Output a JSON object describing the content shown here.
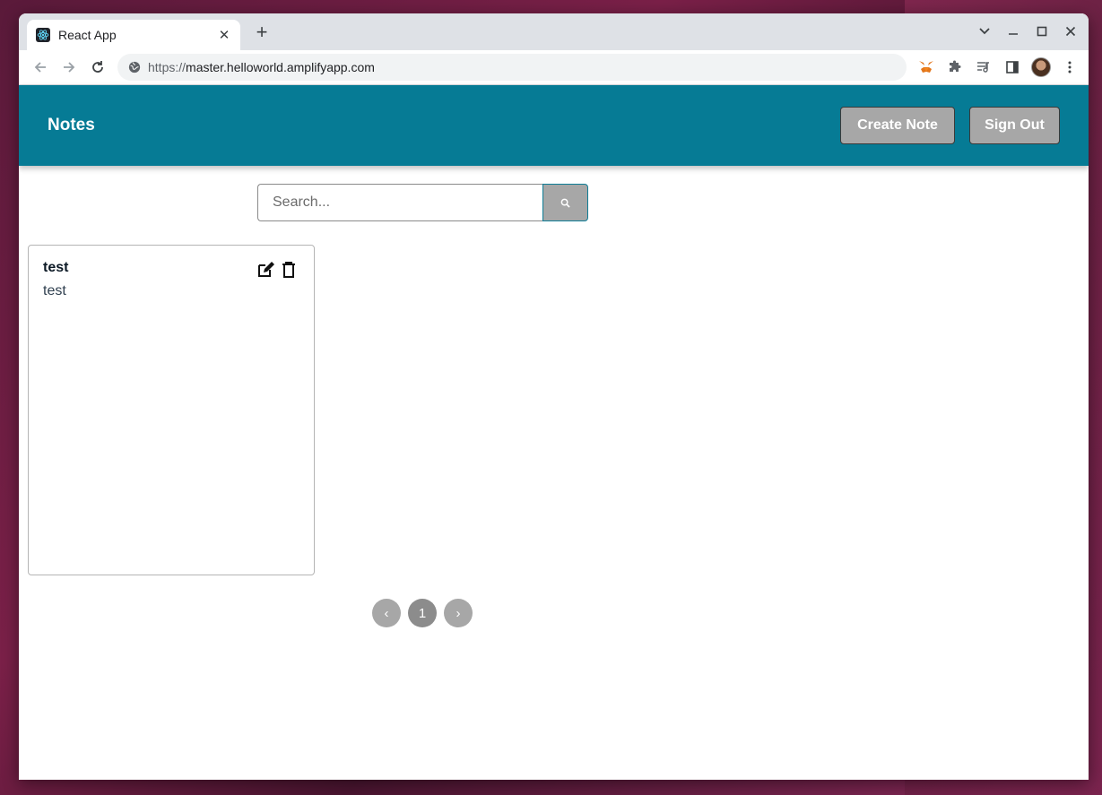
{
  "browser": {
    "tab": {
      "title": "React App",
      "close_glyph": "✕"
    },
    "new_tab_glyph": "+",
    "url": {
      "scheme": "https://",
      "host": "master.helloworld.amplifyapp.com"
    },
    "icons": [
      "back-icon",
      "forward-icon",
      "reload-icon",
      "site-info-icon",
      "metamask-extension-icon",
      "extensions-puzzle-icon",
      "media-control-icon",
      "side-panel-icon",
      "profile-avatar",
      "menu-kebab-icon"
    ]
  },
  "app": {
    "title": "Notes",
    "buttons": {
      "create": "Create Note",
      "signout": "Sign Out"
    },
    "search": {
      "placeholder": "Search..."
    },
    "notes": [
      {
        "title": "test",
        "body": "test"
      }
    ],
    "pagination": {
      "prev": "‹",
      "current": "1",
      "next": "›"
    }
  },
  "colors": {
    "header": "#067b95",
    "button": "#a7a7a7"
  }
}
